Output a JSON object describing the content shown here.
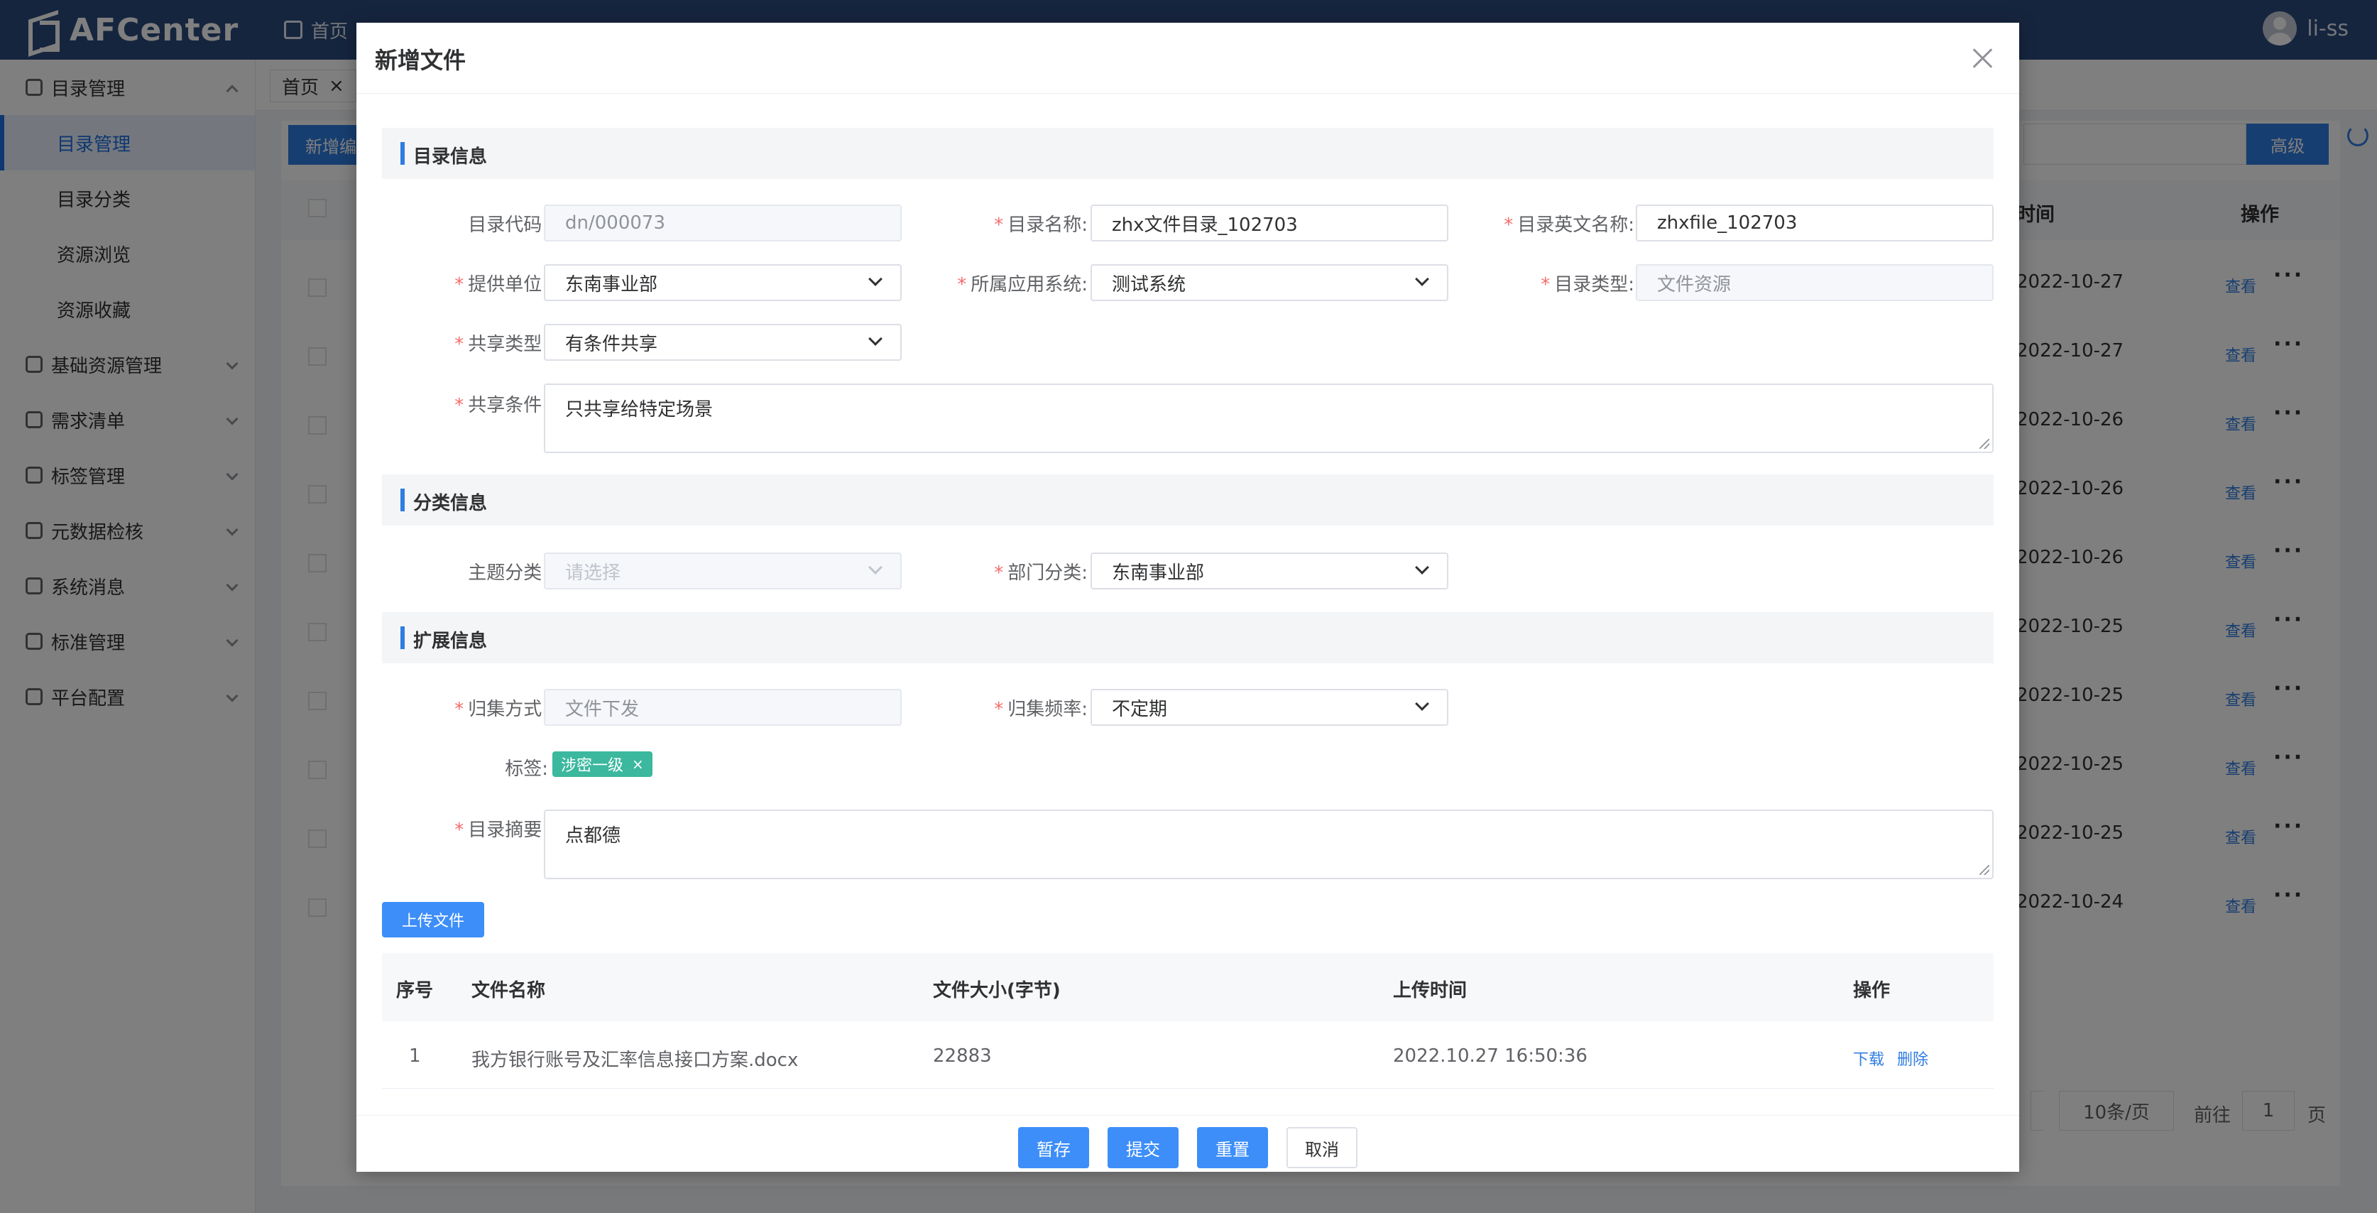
{
  "app": {
    "name": "AFCenter",
    "user": "li-ss"
  },
  "topnav": [
    {
      "label": "首页"
    }
  ],
  "sidebar": [
    {
      "label": "目录管理",
      "expanded": true,
      "children": [
        {
          "label": "目录管理",
          "active": true
        },
        {
          "label": "目录分类"
        },
        {
          "label": "资源浏览"
        },
        {
          "label": "资源收藏"
        }
      ]
    },
    {
      "label": "基础资源管理"
    },
    {
      "label": "需求清单"
    },
    {
      "label": "标签管理"
    },
    {
      "label": "元数据检核"
    },
    {
      "label": "系统消息"
    },
    {
      "label": "标准管理"
    },
    {
      "label": "平台配置"
    }
  ],
  "tabs": [
    {
      "label": "首页",
      "close": "×"
    }
  ],
  "background": {
    "new_button": "新增编",
    "advanced_button": "高级",
    "col_time": "时间",
    "col_ops": "操作",
    "rows": [
      {
        "date": "2022-10-27",
        "view": "查看",
        "more": "···"
      },
      {
        "date": "2022-10-27",
        "view": "查看",
        "more": "···"
      },
      {
        "date": "2022-10-26",
        "view": "查看",
        "more": "···"
      },
      {
        "date": "2022-10-26",
        "view": "查看",
        "more": "···"
      },
      {
        "date": "2022-10-26",
        "view": "查看",
        "more": "···"
      },
      {
        "date": "2022-10-25",
        "view": "查看",
        "more": "···"
      },
      {
        "date": "2022-10-25",
        "view": "查看",
        "more": "···"
      },
      {
        "date": "2022-10-25",
        "view": "查看",
        "more": "···"
      },
      {
        "date": "2022-10-25",
        "view": "查看",
        "more": "···"
      },
      {
        "date": "2022-10-24",
        "view": "查看",
        "more": "···"
      }
    ],
    "pager": {
      "page_size": "10条/页",
      "goto_label": "前往",
      "page": "1",
      "page_suffix": "页"
    }
  },
  "modal": {
    "title": "新增文件",
    "sections": {
      "catalog": "目录信息",
      "classify": "分类信息",
      "extend": "扩展信息"
    },
    "fields": {
      "code": {
        "label": "目录代码:",
        "value": "dn/000073"
      },
      "name": {
        "label": "目录名称:",
        "value": "zhx文件目录_102703",
        "required": true
      },
      "en_name": {
        "label": "目录英文名称:",
        "value": "zhxfile_102703",
        "required": true
      },
      "provider": {
        "label": "提供单位:",
        "value": "东南事业部",
        "required": true
      },
      "app_system": {
        "label": "所属应用系统:",
        "value": "测试系统",
        "required": true
      },
      "catalog_type": {
        "label": "目录类型:",
        "value": "文件资源",
        "required": true
      },
      "share_type": {
        "label": "共享类型:",
        "value": "有条件共享",
        "required": true
      },
      "share_cond": {
        "label": "共享条件:",
        "value": "只共享给特定场景",
        "required": true
      },
      "subject": {
        "label": "主题分类:",
        "placeholder": "请选择"
      },
      "dept": {
        "label": "部门分类:",
        "value": "东南事业部",
        "required": true
      },
      "collect_mode": {
        "label": "归集方式:",
        "value": "文件下发",
        "required": true
      },
      "collect_freq": {
        "label": "归集频率:",
        "value": "不定期",
        "required": true
      },
      "tags": {
        "label": "标签:",
        "items": [
          {
            "text": "涉密一级",
            "close": "×"
          }
        ]
      },
      "summary": {
        "label": "目录摘要:",
        "value": "点都德",
        "required": true
      }
    },
    "required_mark": "*",
    "upload_button": "上传文件",
    "file_table": {
      "headers": {
        "idx": "序号",
        "name": "文件名称",
        "size": "文件大小(字节)",
        "time": "上传时间",
        "ops": "操作"
      },
      "rows": [
        {
          "idx": "1",
          "name": "我方银行账号及汇率信息接口方案.docx",
          "size": "22883",
          "time": "2022.10.27 16:50:36",
          "download": "下载",
          "delete": "删除"
        }
      ]
    },
    "footer": {
      "save_draft": "暂存",
      "submit": "提交",
      "reset": "重置",
      "cancel": "取消"
    }
  },
  "colors": {
    "primary": "#3d8ef8",
    "header_bg": "#2c4a7c",
    "tag": "#3bb89e",
    "required": "#f56c6c"
  }
}
